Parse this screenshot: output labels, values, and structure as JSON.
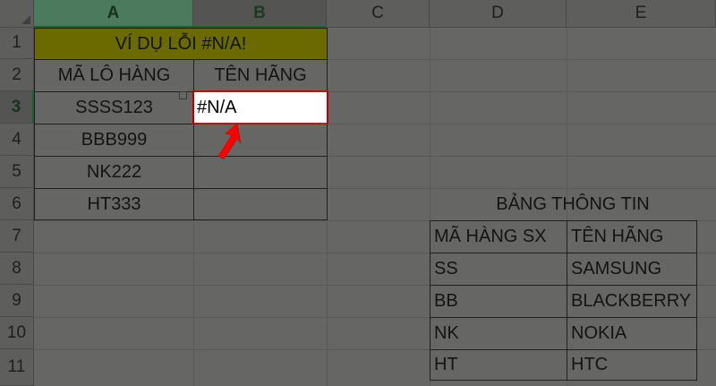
{
  "columns": [
    "A",
    "B",
    "C",
    "D",
    "E"
  ],
  "rows": [
    "1",
    "2",
    "3",
    "4",
    "5",
    "6",
    "7",
    "8",
    "9",
    "10",
    "11"
  ],
  "title": "VÍ DỤ LỖI #N/A!",
  "left_table": {
    "headers": [
      "MÃ LÔ HÀNG",
      "TÊN HÃNG"
    ],
    "codes": [
      "SSSS123",
      "BBB999",
      "NK222",
      "HT333"
    ],
    "active_value": "#N/A"
  },
  "info_table": {
    "title": "BẢNG THÔNG TIN",
    "headers": [
      "MÃ HÀNG SX",
      "TÊN HÃNG"
    ],
    "rows": [
      {
        "code": "SS",
        "brand": "SAMSUNG"
      },
      {
        "code": "BB",
        "brand": "BLACKBERRY"
      },
      {
        "code": "NK",
        "brand": "NOKIA"
      },
      {
        "code": "HT",
        "brand": "HTC"
      }
    ]
  },
  "colors": {
    "title_fill": "#6b6a00",
    "active_border": "#c00000",
    "arrow": "#ff0000",
    "selected_header": "#4b7a5c"
  },
  "annotation": {
    "icon": "red-arrow-pointer-icon"
  }
}
